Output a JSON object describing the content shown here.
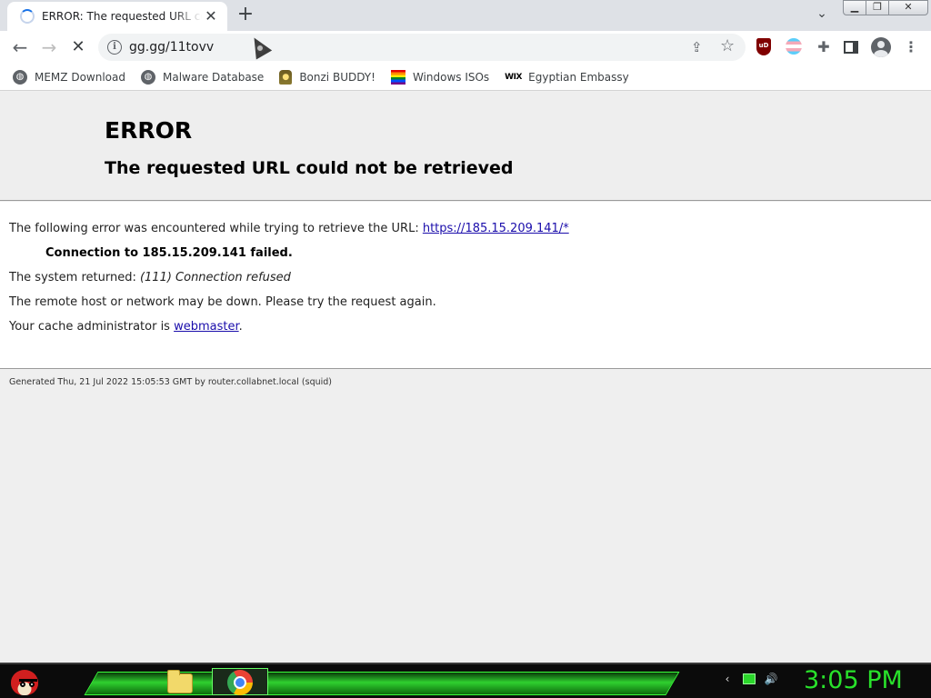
{
  "browser": {
    "tab": {
      "title": "ERROR: The requested URL could not be retrieved",
      "close_glyph": "✕"
    },
    "new_tab_glyph": "+",
    "tab_search_glyph": "⌄",
    "window_controls": {
      "minimize": "▁",
      "restore": "❐",
      "close": "✕"
    },
    "nav": {
      "back": "←",
      "forward": "→",
      "reload": "✕"
    },
    "omnibox": {
      "url": "gg.gg/11tovv",
      "info_glyph": "i"
    },
    "bookmarks": [
      {
        "label": "MEMZ Download",
        "icon": "globe-icon"
      },
      {
        "label": "Malware Database",
        "icon": "globe-icon"
      },
      {
        "label": "Bonzi BUDDY!",
        "icon": "bonzi-icon"
      },
      {
        "label": "Windows ISOs",
        "icon": "rainbow-flag-icon"
      },
      {
        "label": "Egyptian Embassy",
        "icon": "wix-icon"
      }
    ],
    "wix_text": "WIX",
    "ublock_text": "uD"
  },
  "error_page": {
    "heading": "ERROR",
    "subheading": "The requested URL could not be retrieved",
    "intro_text": "The following error was encountered while trying to retrieve the URL: ",
    "url_link": "https://185.15.209.141/*",
    "connection_failed": "Connection to 185.15.209.141 failed.",
    "system_returned_label": "The system returned: ",
    "system_returned_value": "(111) Connection refused",
    "remote_host_text": "The remote host or network may be down. Please try the request again.",
    "cache_admin_text": "Your cache administrator is ",
    "cache_admin_link": "webmaster",
    "cache_admin_suffix": ".",
    "footer": "Generated Thu, 21 Jul 2022 15:05:53 GMT by router.collabnet.local (squid)"
  },
  "taskbar": {
    "clock": "3:05 PM",
    "apps": [
      "file-explorer",
      "google-chrome"
    ],
    "tray": [
      "network-icon",
      "volume-icon"
    ],
    "accent": "#29e22b"
  }
}
